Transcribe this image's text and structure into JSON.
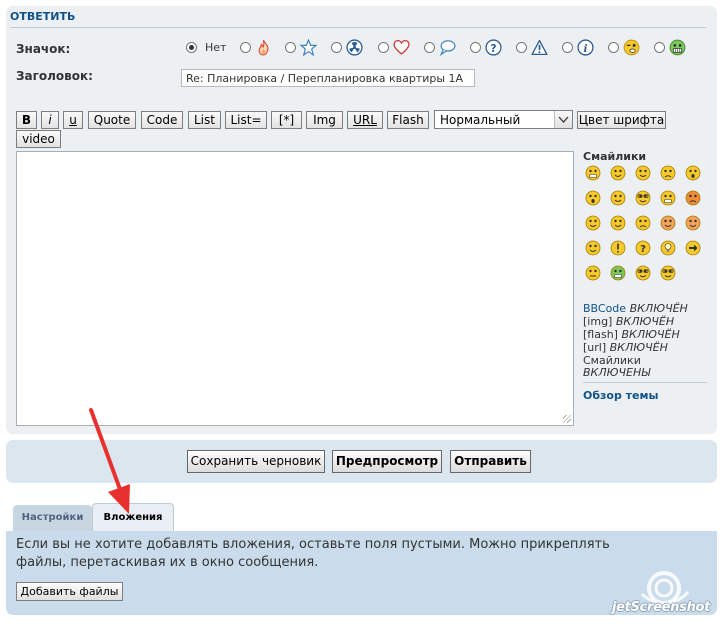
{
  "panel": {
    "title": "ОТВЕТИТЬ"
  },
  "form": {
    "icon_label": "Значок:",
    "subject_label": "Заголовок:",
    "subject_value": "Re: Планировка / Перепланировка квартиры 1А",
    "icon_none_label": "Нет",
    "icon_options": [
      "none",
      "fire-icon",
      "star-icon",
      "radiation-icon",
      "heart-icon",
      "speech-bubble-icon",
      "question-icon",
      "warning-icon",
      "info-icon",
      "wink-icon",
      "grin-icon"
    ],
    "selected_icon": "none"
  },
  "toolbar": {
    "bold": "B",
    "italic": "i",
    "underline": "u",
    "quote": "Quote",
    "code": "Code",
    "list": "List",
    "list_ordered": "List=",
    "list_item": "[*]",
    "img": "Img",
    "url": "URL",
    "flash": "Flash",
    "font_size_selected": "Нормальный",
    "font_color": "Цвет шрифта",
    "video": "video"
  },
  "smilies": {
    "title": "Смайлики",
    "items": [
      "very-happy",
      "smile",
      "wink",
      "sad",
      "surprised",
      "shocked",
      "confused",
      "cool",
      "laughing",
      "mad",
      "razz",
      "embarrassed",
      "crying",
      "evil",
      "twisted-evil",
      "rolling-eyes",
      "exclaim",
      "question",
      "idea",
      "arrow",
      "neutral",
      "green-grin",
      "geek",
      "ugeek"
    ]
  },
  "status": {
    "bbcode_key": "BBCode",
    "bbcode_val": "ВКЛЮЧЁН",
    "img_key": "[img]",
    "img_val": "ВКЛЮЧЁН",
    "flash_key": "[flash]",
    "flash_val": "ВКЛЮЧЁН",
    "url_key": "[url]",
    "url_val": "ВКЛЮЧЁН",
    "smilies_key": "Смайлики",
    "smilies_val": "ВКЛЮЧЕНЫ"
  },
  "topic_review": "Обзор темы",
  "buttons": {
    "save_draft": "Сохранить черновик",
    "preview": "Предпросмотр",
    "submit": "Отправить"
  },
  "tabs": {
    "settings": "Настройки",
    "attachments": "Вложения",
    "active": "attachments"
  },
  "attachments": {
    "note": "Если вы не хотите добавлять вложения, оставьте поля пустыми. Можно прикреплять файлы, перетаскивая их в окно сообщения.",
    "add_files": "Добавить файлы"
  },
  "watermark": "jetScreenshot",
  "colors": {
    "link": "#105289",
    "panel_bg": "#ecf0f3",
    "attach_bg": "#cadceb",
    "arrow": "#e8312f"
  }
}
